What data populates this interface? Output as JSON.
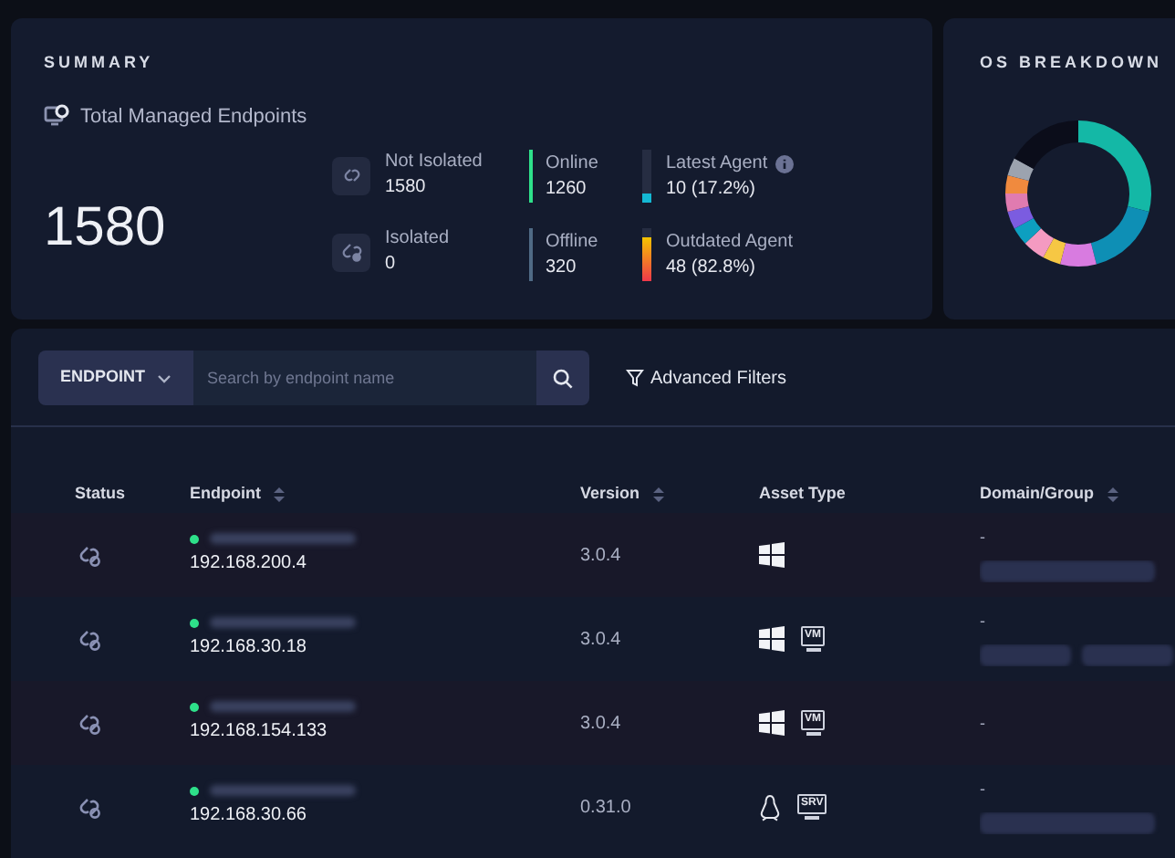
{
  "summary": {
    "title": "SUMMARY",
    "total_label": "Total Managed Endpoints",
    "total": "1580",
    "isolation": [
      {
        "kind": "not_isolated",
        "label": "Not Isolated",
        "value": "1580"
      },
      {
        "kind": "isolated",
        "label": "Isolated",
        "value": "0"
      }
    ],
    "connectivity": [
      {
        "label": "Online",
        "value": "1260",
        "color": "#2ee08a"
      },
      {
        "label": "Offline",
        "value": "320",
        "color": "#4f6a85"
      }
    ],
    "agents": [
      {
        "kind": "latest",
        "label": "Latest Agent",
        "value": "10 (17.2%)",
        "level": 0.172,
        "info": true
      },
      {
        "kind": "outdated",
        "label": "Outdated Agent",
        "value": "48 (82.8%)",
        "level": 0.828,
        "info": false
      }
    ]
  },
  "os_breakdown": {
    "title": "OS BREAKDOWN"
  },
  "toolbar": {
    "scope": "ENDPOINT",
    "search": {
      "placeholder": "Search by endpoint name"
    },
    "advanced_filters": "Advanced Filters"
  },
  "table": {
    "columns": [
      {
        "label": "Status",
        "sortable": false
      },
      {
        "label": "Endpoint",
        "sortable": true
      },
      {
        "label": "Version",
        "sortable": true
      },
      {
        "label": "Asset Type",
        "sortable": false
      },
      {
        "label": "Domain/Group",
        "sortable": true
      }
    ],
    "rows": [
      {
        "online": true,
        "ip": "192.168.200.4",
        "version": "3.0.4",
        "assets": [
          {
            "kind": "windows"
          }
        ],
        "domain": "-",
        "tags": [
          {
            "kind": "blurred"
          }
        ]
      },
      {
        "online": true,
        "ip": "192.168.30.18",
        "version": "3.0.4",
        "assets": [
          {
            "kind": "windows"
          },
          {
            "kind": "vm",
            "label": "VM"
          }
        ],
        "domain": "-",
        "tags": [
          {
            "kind": "blurred"
          },
          {
            "kind": "blurred"
          }
        ]
      },
      {
        "online": true,
        "ip": "192.168.154.133",
        "version": "3.0.4",
        "assets": [
          {
            "kind": "windows"
          },
          {
            "kind": "vm",
            "label": "VM"
          }
        ],
        "domain": "-"
      },
      {
        "online": true,
        "ip": "192.168.30.66",
        "version": "0.31.0",
        "assets": [
          {
            "kind": "linux"
          },
          {
            "kind": "server",
            "label": "SRV"
          }
        ],
        "domain": "-",
        "tags": [
          {
            "kind": "blurred"
          }
        ]
      }
    ]
  }
}
